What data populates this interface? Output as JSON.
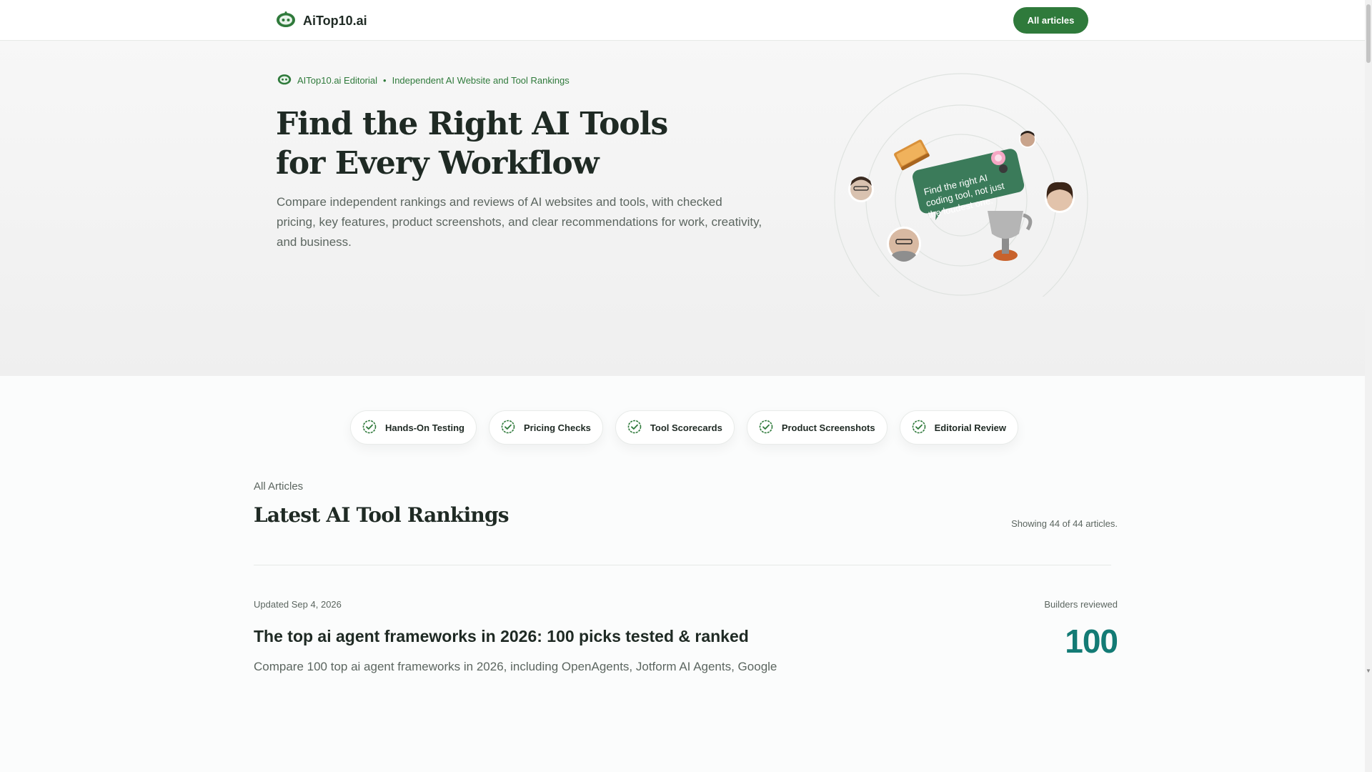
{
  "header": {
    "brand_name": "AiTop10.ai",
    "cta_label": "All articles"
  },
  "hero": {
    "eyebrow_author": "AITop10.ai Editorial",
    "eyebrow_separator": "•",
    "eyebrow_tagline": "Independent AI Website and Tool Rankings",
    "title_line1": "Find the Right AI Tools",
    "title_line2": "for Every Workflow",
    "subtitle": "Compare independent rankings and reviews of AI websites and tools, with checked pricing, key features, product screenshots, and clear recommendations for work, creativity, and business.",
    "bubble_line1": "Find the right AI",
    "bubble_line2": "coding tool, not just",
    "bubble_line3": "the loudest one."
  },
  "chips": [
    {
      "label": "Hands-On Testing",
      "icon": "check-badge-icon"
    },
    {
      "label": "Pricing Checks",
      "icon": "check-badge-icon"
    },
    {
      "label": "Tool Scorecards",
      "icon": "check-badge-icon"
    },
    {
      "label": "Product Screenshots",
      "icon": "check-badge-icon"
    },
    {
      "label": "Editorial Review",
      "icon": "check-badge-icon"
    }
  ],
  "articles_section": {
    "label": "All Articles",
    "title": "Latest AI Tool Rankings",
    "showing": "Showing 44 of 44 articles."
  },
  "article": {
    "date": "Updated Sep 4, 2026",
    "meta_label": "Builders reviewed",
    "title": "The top ai agent frameworks in 2026: 100 picks tested & ranked",
    "count": "100",
    "description": "Compare 100 top ai agent frameworks in 2026, including OpenAgents, Jotform AI Agents, Google"
  },
  "colors": {
    "brand_green": "#2f7a3b",
    "count_teal": "#137b75",
    "text_dark": "#1f2a24",
    "text_muted": "#5c6660"
  }
}
